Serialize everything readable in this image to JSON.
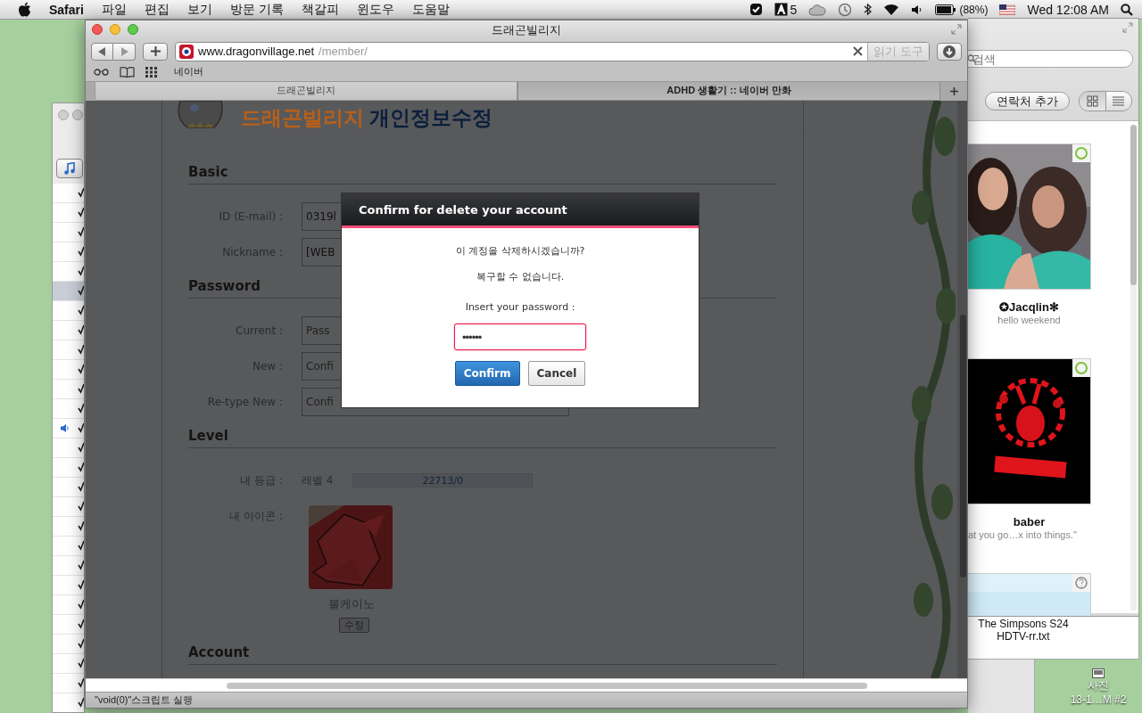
{
  "menu_bar": {
    "app": "Safari",
    "menus": [
      "파일",
      "편집",
      "보기",
      "방문 기록",
      "책갈피",
      "윈도우",
      "도움말"
    ],
    "adobe_count": "5",
    "battery": "(88%)",
    "clock": "Wed 12:08 AM"
  },
  "music_window": {
    "rows": [
      {
        "checked": true,
        "selected": false,
        "playing": false
      },
      {
        "checked": true,
        "selected": false,
        "playing": false
      },
      {
        "checked": true,
        "selected": false,
        "playing": false
      },
      {
        "checked": true,
        "selected": false,
        "playing": false
      },
      {
        "checked": true,
        "selected": false,
        "playing": false
      },
      {
        "checked": true,
        "selected": true,
        "playing": false
      },
      {
        "checked": true,
        "selected": false,
        "playing": false
      },
      {
        "checked": true,
        "selected": false,
        "playing": false
      },
      {
        "checked": true,
        "selected": false,
        "playing": false
      },
      {
        "checked": true,
        "selected": false,
        "playing": false
      },
      {
        "checked": true,
        "selected": false,
        "playing": false
      },
      {
        "checked": true,
        "selected": false,
        "playing": false
      },
      {
        "checked": true,
        "selected": false,
        "playing": true
      },
      {
        "checked": true,
        "selected": false,
        "playing": false
      },
      {
        "checked": true,
        "selected": false,
        "playing": false
      },
      {
        "checked": true,
        "selected": false,
        "playing": false
      },
      {
        "checked": true,
        "selected": false,
        "playing": false
      },
      {
        "checked": true,
        "selected": false,
        "playing": false
      },
      {
        "checked": true,
        "selected": false,
        "playing": false
      },
      {
        "checked": true,
        "selected": false,
        "playing": false
      },
      {
        "checked": true,
        "selected": false,
        "playing": false
      },
      {
        "checked": true,
        "selected": false,
        "playing": false
      },
      {
        "checked": true,
        "selected": false,
        "playing": false
      },
      {
        "checked": true,
        "selected": false,
        "playing": false
      },
      {
        "checked": true,
        "selected": false,
        "playing": false
      },
      {
        "checked": true,
        "selected": false,
        "playing": false
      },
      {
        "checked": true,
        "selected": false,
        "playing": false
      }
    ]
  },
  "contacts_window": {
    "search": {
      "placeholder": "검색"
    },
    "add_button": "연락처 추가",
    "views": [
      {
        "kind": "grid",
        "selected": true
      },
      {
        "kind": "list",
        "selected": false
      }
    ],
    "contacts": [
      {
        "kind": "friends",
        "online": true,
        "name": "✪Jacqlin✻",
        "mood": "hello weekend"
      },
      {
        "kind": "poster",
        "online": true,
        "name": "baber",
        "mood": "at you go…x into things.\""
      },
      {
        "kind": "plain",
        "online": false
      }
    ]
  },
  "file_window": {
    "file_name": [
      "The Simpsons S24",
      "HDTV-rr.txt"
    ]
  },
  "desktop_icon": {
    "label": [
      "사진",
      "13-1…M #2"
    ]
  },
  "browser": {
    "title": "드래곤빌리지",
    "url_host": "www.dragonvillage.net",
    "url_path": "/member/",
    "reader_button": "읽기 도구",
    "bookmarks": [
      "네이버"
    ],
    "tabs": [
      {
        "label": "드래곤빌리지",
        "selected": true
      },
      {
        "label": "ADHD 생활기 :: 네이버 만화",
        "selected": false
      }
    ],
    "status": "\"void(0)\"스크립트 실행"
  },
  "page": {
    "logo_brand": "드래곤빌리지",
    "logo_title": "개인정보수정",
    "sections": [
      {
        "title": "Basic",
        "rows": [
          {
            "kind": "field",
            "label": "ID (E-mail) :",
            "value": "0319l"
          },
          {
            "kind": "field",
            "label": "Nickname :",
            "value": "[WEB"
          }
        ]
      },
      {
        "title": "Password",
        "rows": [
          {
            "kind": "field",
            "label": "Current :",
            "placeholder": "Pass"
          },
          {
            "kind": "field",
            "label": "New :",
            "placeholder": "Confi"
          },
          {
            "kind": "field",
            "label": "Re-type New :",
            "placeholder": "Confi"
          }
        ]
      },
      {
        "title": "Level",
        "rows": [
          {
            "kind": "level",
            "label": "내 등급 :",
            "value": "레벨 4",
            "bar_text": "22713/0"
          },
          {
            "kind": "avatar",
            "label": "내 아이콘 :",
            "name": "불케이노",
            "button": "수정"
          }
        ]
      },
      {
        "title": "Account"
      }
    ]
  },
  "dialog": {
    "title": "Confirm for delete your account",
    "messages": [
      "이 계정을 삭제하시겠습니까?",
      "복구할 수 없습니다."
    ],
    "prompt": "Insert your password :",
    "password": "••••••",
    "focused": true,
    "buttons": [
      {
        "label": "Confirm",
        "kind": "primary"
      },
      {
        "label": "Cancel",
        "kind": "secondary"
      }
    ]
  }
}
